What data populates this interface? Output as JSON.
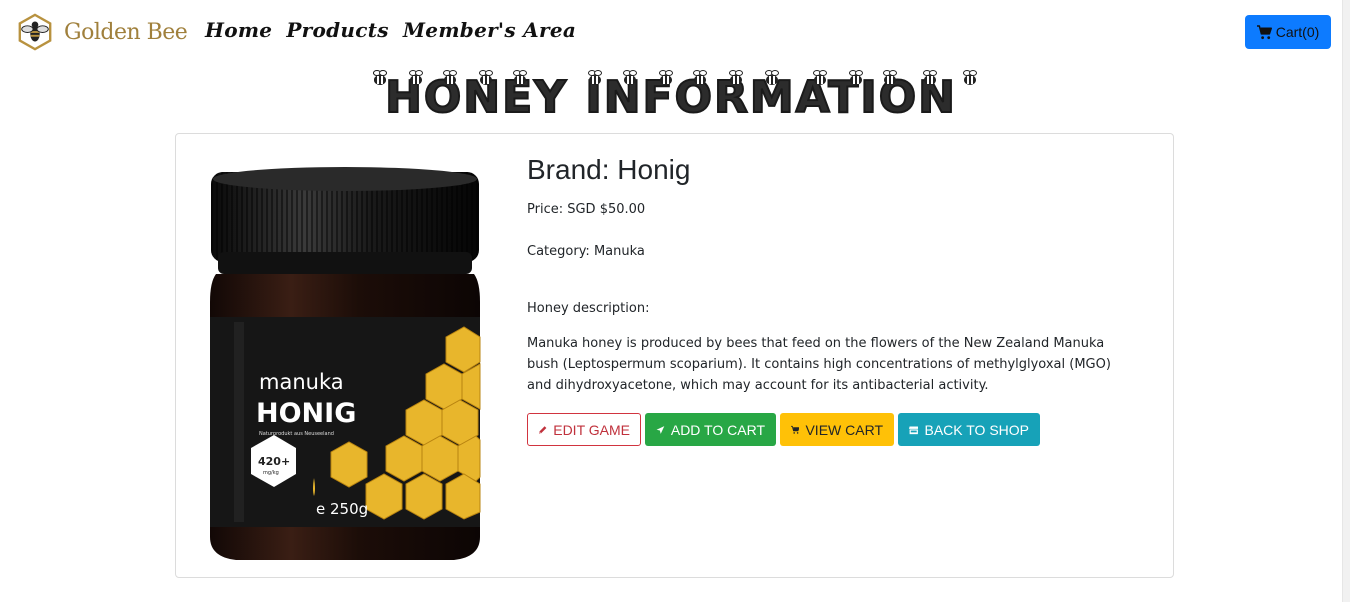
{
  "navbar": {
    "brand_name": "Golden Bee",
    "links": [
      "Home",
      "Products",
      "Member's Area"
    ],
    "cart_label": "Cart(0)",
    "accent_color": "#0d7bff"
  },
  "page": {
    "title": "HONEY INFORMATION"
  },
  "product": {
    "brand_heading": "Brand: Honig",
    "price": "Price: SGD $50.00",
    "category": "Category: Manuka",
    "description_label": "Honey description:",
    "description": "Manuka honey is produced by bees that feed on the flowers of the New Zealand Manuka bush (Leptospermum scoparium). It contains high concentrations of methylglyoxal (MGO) and dihydroxyacetone, which may account for its antibacterial activity.",
    "image_label": {
      "name": "manuka",
      "brand": "HONIG",
      "subtitle": "Naturprodukt aus Neuseeland",
      "mgo": "420+",
      "mgo_unit": "mg/kg",
      "weight": "e 250g"
    }
  },
  "actions": {
    "edit": "EDIT GAME",
    "add": "ADD TO CART",
    "view": "VIEW CART",
    "back": "BACK TO SHOP"
  },
  "icons": {
    "cart": "cart-icon",
    "edit": "pencil-icon",
    "add": "paper-plane-icon",
    "view": "cart-icon",
    "back": "store-icon"
  }
}
